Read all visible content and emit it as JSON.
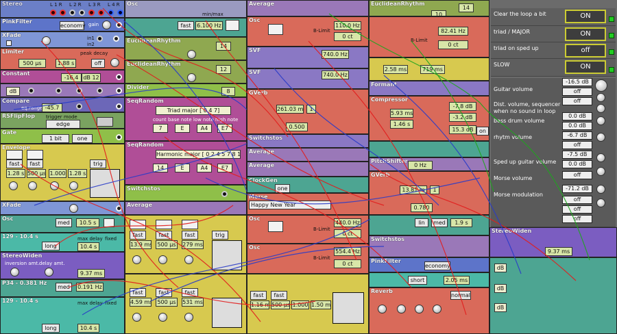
{
  "modules": {
    "col1": [
      {
        "title": "PinkFilter",
        "color": "#5d74c9",
        "mode": "economy",
        "gain": "gain"
      },
      {
        "title": "XFade",
        "color": "#7f96d6"
      },
      {
        "title": "Limiter",
        "color": "#d96a5a",
        "peak_label": "peak decay",
        "a_val": "500 µs",
        "b_val": "1.88 s",
        "off": "off"
      },
      {
        "title": "Constant",
        "color": "#b04e97",
        "v1": "-16.4",
        "v2": "dB 12"
      },
      {
        "title": "Scale",
        "color": "#9a78b8",
        "unit": "dB"
      },
      {
        "title": "Compare",
        "color": "#6c67b8",
        "label": "eq.range",
        "val": "-45.7"
      },
      {
        "title": "RSFlipFlop",
        "color": "#7aa360",
        "trigger": "trigger mode",
        "edge": "edge"
      },
      {
        "title": "Gate",
        "color": "#8fbf49",
        "bits": "1 bit",
        "one": "one"
      },
      {
        "title": "Envelope",
        "color": "#d7c94f",
        "f1": "fast",
        "f2": "fast",
        "t1": "1.28 s",
        "t2": "500 µs",
        "t3": "1.000",
        "t4": "1.28 s",
        "trig": "trig"
      },
      {
        "title": "XFade",
        "color": "#7f96d6"
      },
      {
        "title": "Osc",
        "color": "#4da592",
        "med": "med",
        "v": "10.5 s"
      },
      {
        "title": "Delay",
        "color": "#4bb9a7",
        "long": "long",
        "max": "max delay",
        "v": "10.4 s",
        "fixed": "fixed"
      },
      {
        "title": "StereoWiden",
        "color": "#7b5dc1",
        "l1": "inversion amt.",
        "l2": "delay amt.",
        "v": "9.37 ms"
      },
      {
        "title": "Osc",
        "color": "#4da592",
        "med": "med",
        "v": "0.191 Hz"
      },
      {
        "title": "Delay",
        "color": "#4bb9a7",
        "long": "long",
        "max": "max delay",
        "v": "10.4 s",
        "fixed": "fixed"
      }
    ],
    "col2_values": {
      "osc_freq": "6.100 Hz",
      "fast": "fast",
      "euclid1_title": "EuclideanRhythm",
      "euclid1_steps": "14",
      "euclid2_title": "EuclideanRhythm",
      "euclid2_steps": "12",
      "divider": "Divider",
      "divider_val": "8",
      "seq1_title": "SeqRandom",
      "seq1_scale": "Triad major [ 0 4 7]",
      "seq1_count": "7",
      "seq1_base": "E",
      "seq1_low": "A4",
      "seq1_high": "E7",
      "seq2_title": "SeqRandom",
      "seq2_scale": "Harmonic major [ 0 2 4 5 7 8 11]",
      "seq2_count": "14",
      "seq2_base": "E",
      "seq2_low": "A4",
      "seq2_high": "E7",
      "switch_title": "Switchstos",
      "avg_title": "Average",
      "env_f1": "fast",
      "env_f2": "fast",
      "env_f3": "fast",
      "env_t1": "13.9 ms",
      "env_t2": "500 µs",
      "env_t3": "279 ms",
      "env_b1": "fast",
      "env_b2": "fast",
      "env_b3": "fast",
      "env_bt1": "4.59 ms",
      "env_bt2": "500 µs",
      "env_bt3": "531 ms",
      "trig": "trig",
      "minmax": "min/max"
    },
    "col3_values": {
      "avg_title": "Average",
      "osc_title": "Osc",
      "osc_freq": "110.0 Hz",
      "osc_ct": "0 ct",
      "blimit": "B-Limit",
      "svf1_title": "SVF",
      "svf1_freq": "740.0 Hz",
      "svf2_title": "SVF",
      "svf2_freq": "740.0 Hz",
      "gverb_title": "GVerb",
      "gverb_room": "261.03 m",
      "gverb_one": "1",
      "gverb_size": "0.500",
      "switch_title": "Switchstos",
      "avg2_title": "Average",
      "avg3_title": "Average",
      "clock_title": "ClockGen",
      "clock_one": "one",
      "morse_title": "Morse",
      "morse_text": "Happy New Year",
      "osc2_freq": "440.0 Hz",
      "osc2_ct": "0 ct",
      "osc3_freq": "554.4 Hz",
      "osc3_ct": "0 ct",
      "env_f1": "fast",
      "env_f2": "fast",
      "env_t1": "1.16 ms",
      "env_t2": "500 µs",
      "env_t3": "1.000",
      "env_t4": "1.50 ms"
    },
    "col4_values": {
      "euclid_title": "EuclideanRhythm",
      "euclid_steps": "14",
      "euclid_pattern": "10",
      "osc_freq": "82.41 Hz",
      "osc_ct": "0 ct",
      "blimit": "B-Limit",
      "env_t": "2.58 ms",
      "env_r": "719 ms",
      "formant_title": "Formant",
      "comp_title": "Compressor",
      "comp_a": "5.93 ms",
      "comp_r": "1.46 s",
      "comp_th": "-7.8 dB",
      "comp_rel": "-3.2 dB",
      "comp_gain": "15.3 dB",
      "comp_on": "on",
      "pitch_title": "PitchShifter",
      "pitch_val": "0 Hz",
      "gverb_title": "GVerb",
      "gverb_room": "13.81 m",
      "gverb_one": "1",
      "gverb_size": "0.780",
      "lin": "lin",
      "med": "med",
      "osc_hz": "1.9 s",
      "switch_title": "Switchstos",
      "pink_title": "PinkFilter",
      "pink_mode": "economy",
      "short": "short",
      "delay": "2.05 ms",
      "normal": "normal",
      "reverb_title": "Reverb",
      "stereo_title": "StereoWiden",
      "stereo_v": "9.37 ms",
      "db": "dB"
    }
  },
  "panel": {
    "toggles": [
      {
        "label": "Clear the loop a bit",
        "value": "ON"
      },
      {
        "label": "triad / MAJOR",
        "value": "ON"
      },
      {
        "label": "triad on sped up",
        "value": "off"
      },
      {
        "label": "SLOW",
        "value": "ON"
      }
    ],
    "volumes": [
      {
        "label": "Guitar volume",
        "value": "-16.5 dB"
      },
      {
        "label": "",
        "value": "off"
      },
      {
        "label": "Dist. volume, sequencer when no sound in loop",
        "value": "off"
      },
      {
        "label": "bass drum volume",
        "value": "0.0 dB"
      },
      {
        "label": "",
        "value": "0.0 dB"
      },
      {
        "label": "rhytm volume",
        "value": "-6.7 dB"
      },
      {
        "label": "",
        "value": "off"
      },
      {
        "label": "Sped up guitar volume",
        "value": "-7.5 dB"
      },
      {
        "label": "",
        "value": "0.0 dB"
      },
      {
        "label": "Morse volume",
        "value": "off"
      },
      {
        "label": "",
        "value": "-71.2 dB"
      },
      {
        "label": "Morse modulation",
        "value": "off"
      },
      {
        "label": "",
        "value": "off"
      },
      {
        "label": "",
        "value": "off"
      }
    ]
  },
  "io_labels": {
    "l1r": "L 1 R",
    "l2r": "L 2 R",
    "l3r": "L 3 R",
    "l4r": "L 4 R"
  },
  "colors": {
    "cable_red": "#e21d1d",
    "cable_blue": "#2a3cc8",
    "cable_green": "#1fa51f",
    "toggle_border": "#cccc33"
  }
}
